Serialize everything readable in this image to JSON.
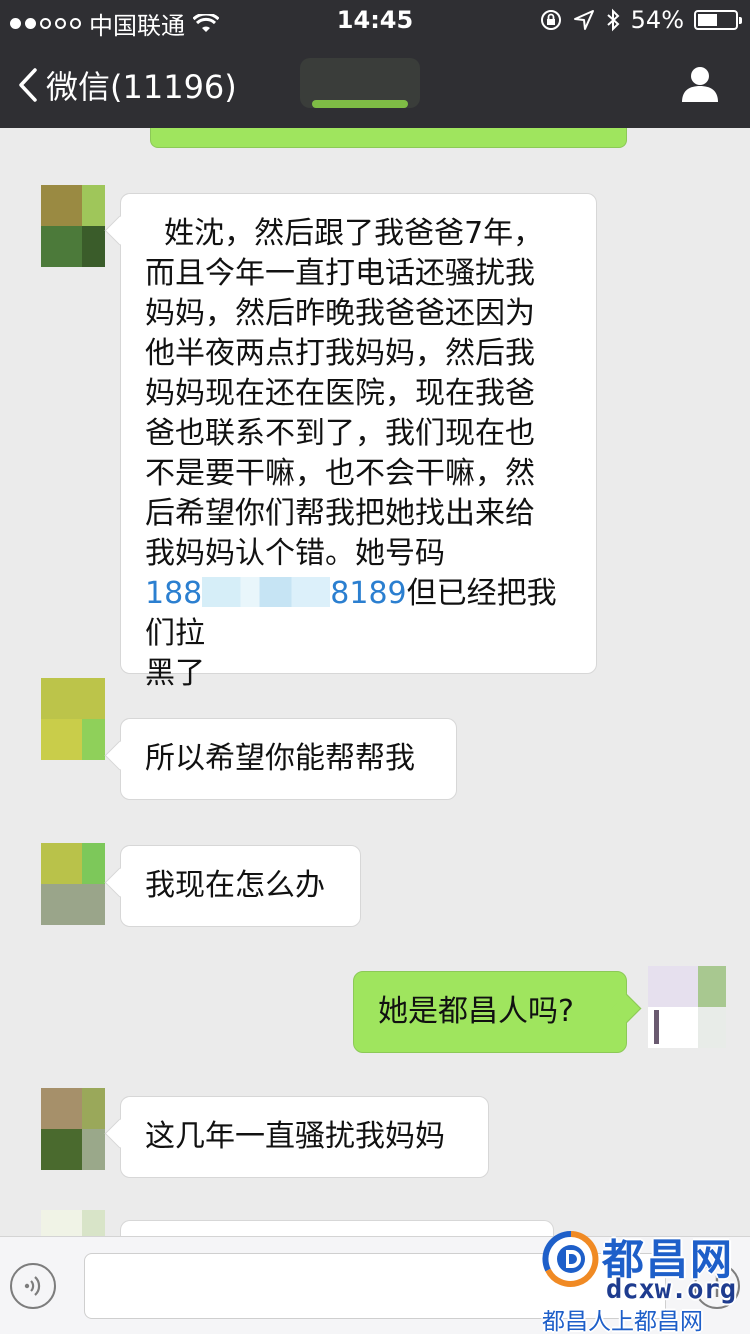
{
  "status_bar": {
    "carrier": "中国联通",
    "time": "14:45",
    "battery_text": "54%",
    "battery_level": 0.54,
    "signal_full_dots": 2,
    "signal_total_dots": 5
  },
  "nav": {
    "back_label": "微信(11196)",
    "back_icon": "chevron-left-icon",
    "profile_icon": "person-icon"
  },
  "messages": [
    {
      "sender": "other",
      "lines": [
        "  姓沈，然后跟了我爸爸7年，",
        "而且今年一直打电话还骚扰我",
        "妈妈，然后昨晚我爸爸还因为",
        "他半夜两点打我妈妈，然后我",
        "妈妈现在还在医院，现在我爸",
        "爸也联系不到了，我们现在也",
        "不是要干嘛，也不会干嘛，然",
        "后希望你们帮我把她找出来给",
        "我妈妈认个错。她号码"
      ],
      "phone_start": "188",
      "phone_end": "8189",
      "after_phone": "但已经把我们拉",
      "last_line": "黑了"
    },
    {
      "sender": "other",
      "text": "所以希望你能帮帮我"
    },
    {
      "sender": "other",
      "text": "我现在怎么办"
    },
    {
      "sender": "me",
      "text": "她是都昌人吗?"
    },
    {
      "sender": "other",
      "text": "这几年一直骚扰我妈妈"
    }
  ],
  "input_bar": {
    "voice_icon": "voice-icon",
    "add_icon": "plus-icon"
  },
  "watermark": {
    "title": "都昌网",
    "domain": "dcxw.org",
    "slogan": "都昌人上都昌网"
  },
  "colors": {
    "header_bg": "#2f2f33",
    "chat_bg": "#ebebeb",
    "my_bubble": "#9fe55e",
    "their_bubble": "#ffffff",
    "link": "#2b7fd0"
  }
}
